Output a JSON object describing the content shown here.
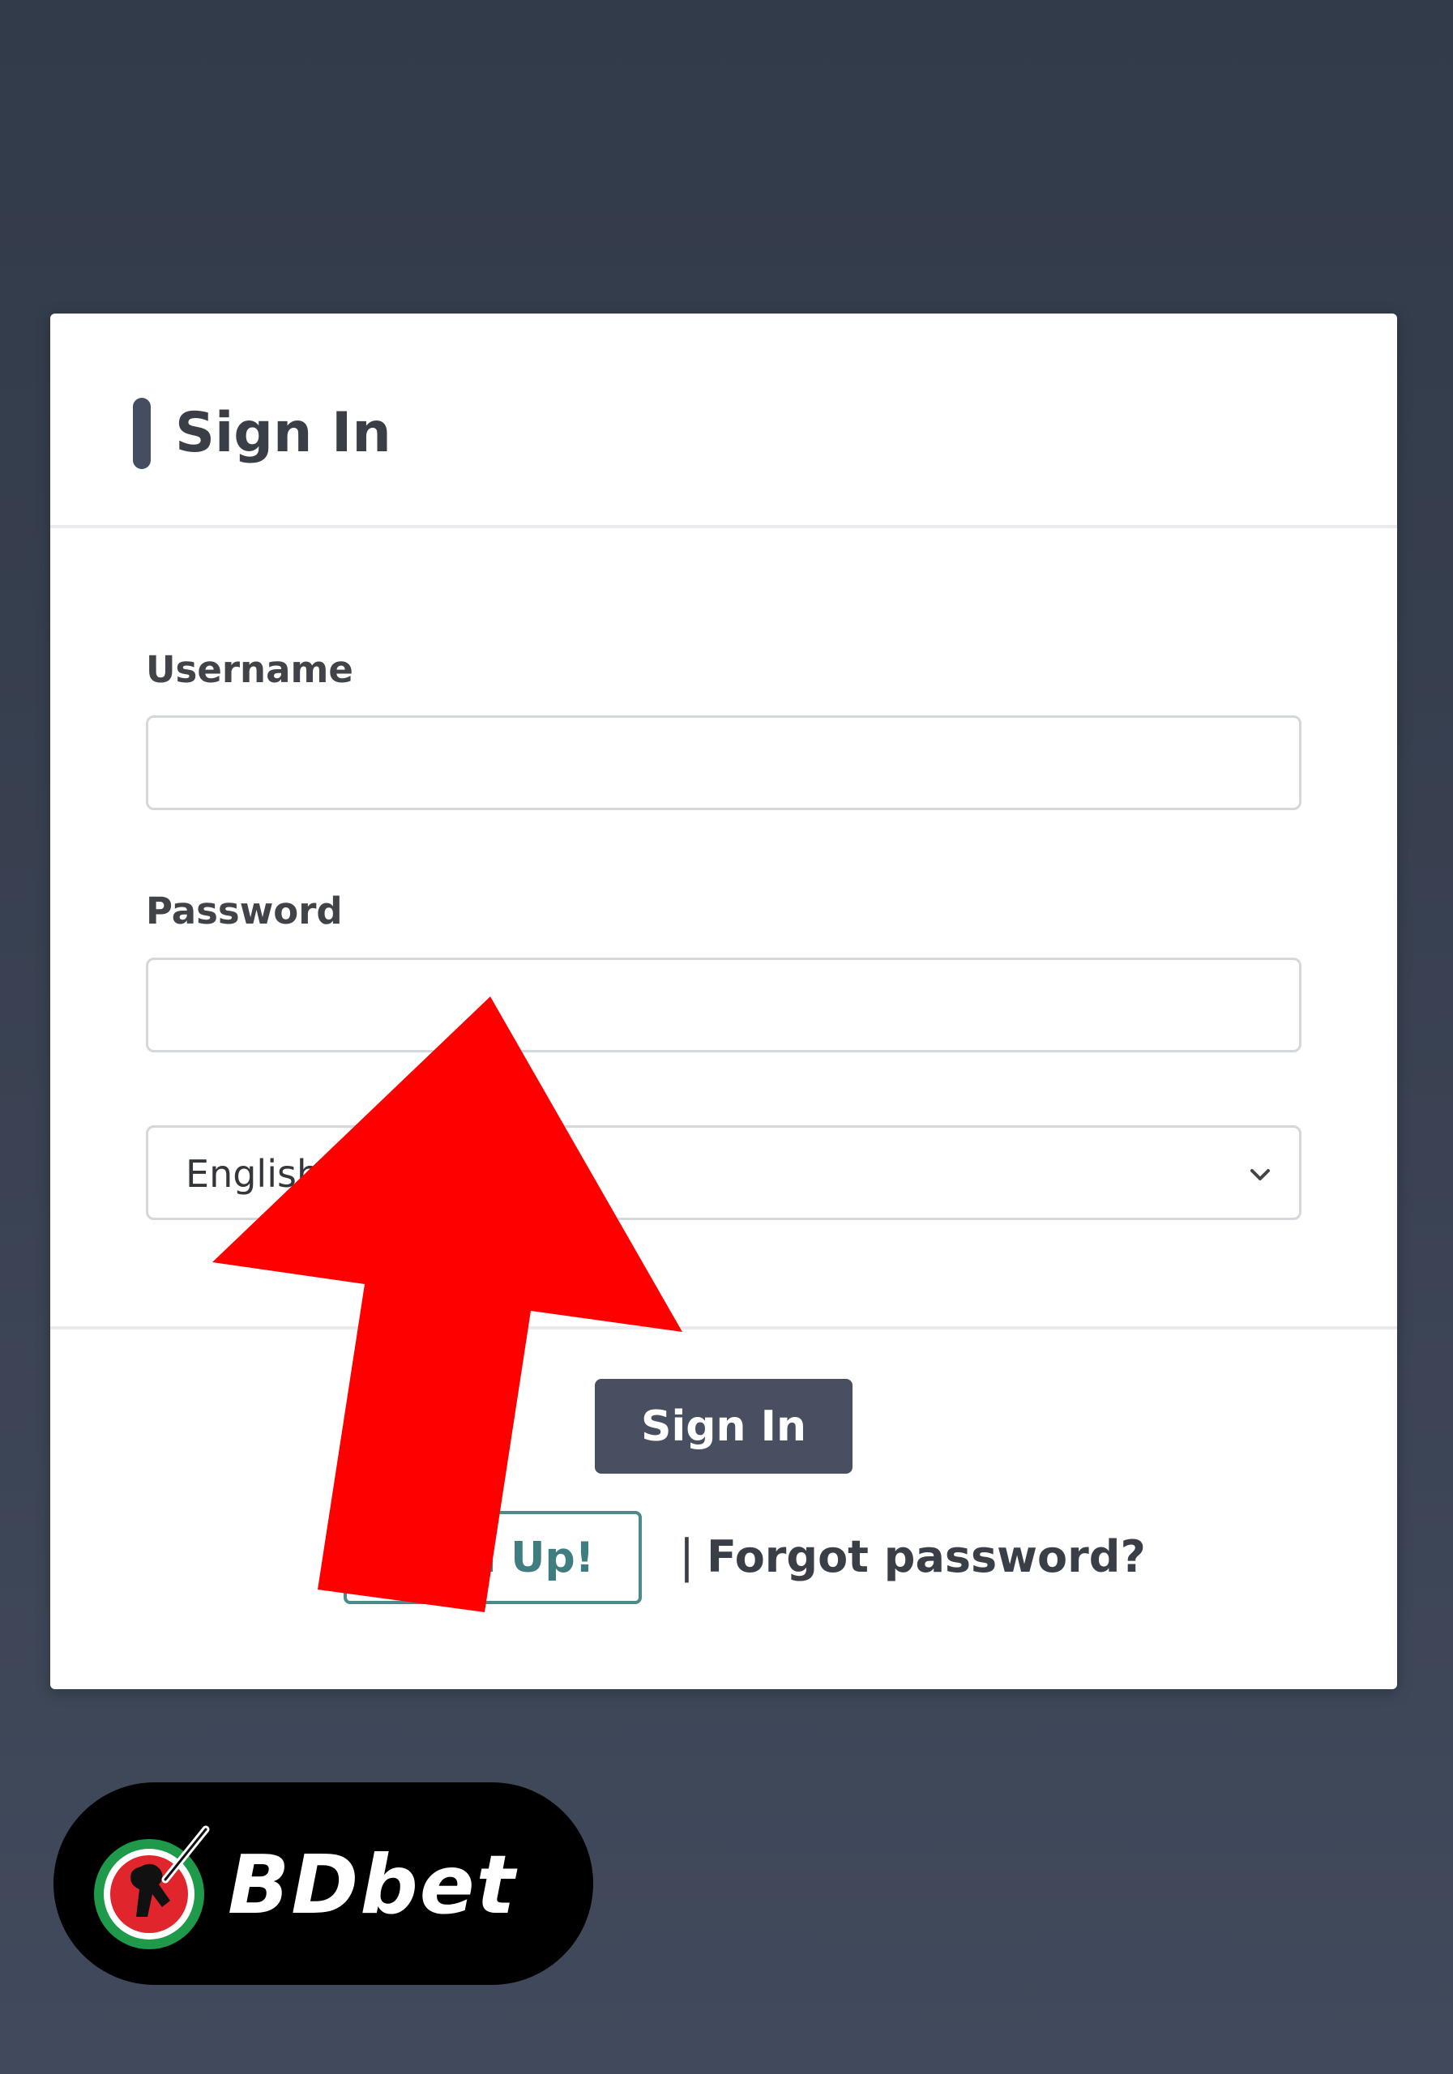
{
  "login_card": {
    "title": "Sign In",
    "username_label": "Username",
    "username_value": "",
    "password_label": "Password",
    "password_value": "",
    "language_selected": "English",
    "signin_button_label": "Sign In",
    "signup_button_label": "Sign Up!",
    "separator": "|",
    "forgot_password_label": "Forgot password?"
  },
  "overlay": {
    "arrow_color": "#ff0000",
    "arrow_icon": "up-arrow-icon"
  },
  "brand": {
    "logo_text": "BDbet",
    "logo_icon": "cricket-batsman-icon",
    "colors": {
      "badge_background": "#000000",
      "ring_green": "#1f9a4b",
      "ring_red": "#e0262c"
    }
  },
  "colors": {
    "primary_button": "#474f61",
    "signup_accent": "#3e7e80",
    "page_background": "#363e4e"
  }
}
